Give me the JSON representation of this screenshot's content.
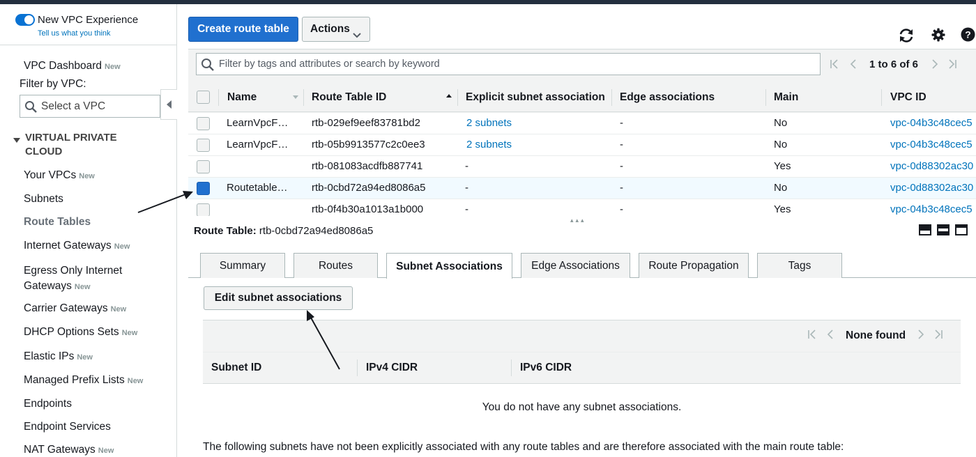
{
  "sidebar": {
    "experience_title": "New VPC Experience",
    "experience_link": "Tell us what you think",
    "dashboard": {
      "label": "VPC Dashboard",
      "badge": "New"
    },
    "filter_label": "Filter by VPC:",
    "filter_placeholder": "Select a VPC",
    "section_title": "VIRTUAL PRIVATE CLOUD",
    "items": [
      {
        "label": "Your VPCs",
        "badge": "New"
      },
      {
        "label": "Subnets",
        "badge": ""
      },
      {
        "label": "Route Tables",
        "badge": ""
      },
      {
        "label": "Internet Gateways",
        "badge": "New"
      },
      {
        "label": "Egress Only Internet",
        "label2": "Gateways",
        "badge": "New"
      },
      {
        "label": "Carrier Gateways",
        "badge": "New"
      },
      {
        "label": "DHCP Options Sets",
        "badge": "New"
      },
      {
        "label": "Elastic IPs",
        "badge": "New"
      },
      {
        "label": "Managed Prefix Lists",
        "badge": "New"
      },
      {
        "label": "Endpoints",
        "badge": ""
      },
      {
        "label": "Endpoint Services",
        "badge": ""
      },
      {
        "label": "NAT Gateways",
        "badge": "New"
      }
    ]
  },
  "toolbar": {
    "create_label": "Create route table",
    "actions_label": "Actions"
  },
  "search": {
    "placeholder": "Filter by tags and attributes or search by keyword"
  },
  "pagination": {
    "text": "1 to 6 of 6"
  },
  "table": {
    "columns": [
      "Name",
      "Route Table ID",
      "Explicit subnet association",
      "Edge associations",
      "Main",
      "VPC ID"
    ],
    "rows": [
      {
        "name": "LearnVpcF…",
        "id": "rtb-029ef9eef83781bd2",
        "explicit": "2 subnets",
        "edge": "-",
        "main": "No",
        "vpc": "vpc-04b3c48cec5",
        "checked": false
      },
      {
        "name": "LearnVpcF…",
        "id": "rtb-05b9913577c2c0ee3",
        "explicit": "2 subnets",
        "edge": "-",
        "main": "No",
        "vpc": "vpc-04b3c48cec5",
        "checked": false
      },
      {
        "name": "",
        "id": "rtb-081083acdfb887741",
        "explicit": "-",
        "edge": "-",
        "main": "Yes",
        "vpc": "vpc-0d88302ac30",
        "checked": false
      },
      {
        "name": "Routetable…",
        "id": "rtb-0cbd72a94ed8086a5",
        "explicit": "-",
        "edge": "-",
        "main": "No",
        "vpc": "vpc-0d88302ac30",
        "checked": true
      },
      {
        "name": "",
        "id": "rtb-0f4b30a1013a1b000",
        "explicit": "-",
        "edge": "-",
        "main": "Yes",
        "vpc": "vpc-04b3c48cec5",
        "checked": false
      }
    ]
  },
  "detail": {
    "label": "Route Table:",
    "value": "rtb-0cbd72a94ed8086a5",
    "tabs": [
      "Summary",
      "Routes",
      "Subnet Associations",
      "Edge Associations",
      "Route Propagation",
      "Tags"
    ],
    "active_tab": "Subnet Associations",
    "edit_button": "Edit subnet associations",
    "pager_text": "None found",
    "sub_columns": [
      "Subnet ID",
      "IPv4 CIDR",
      "IPv6 CIDR"
    ],
    "empty_message": "You do not have any subnet associations.",
    "footer_note": "The following subnets have not been explicitly associated with any route tables and are therefore associated with the main route table:"
  },
  "colors": {
    "primary": "#2070cf",
    "link": "#0073bb",
    "selected_row": "#f1faff"
  }
}
